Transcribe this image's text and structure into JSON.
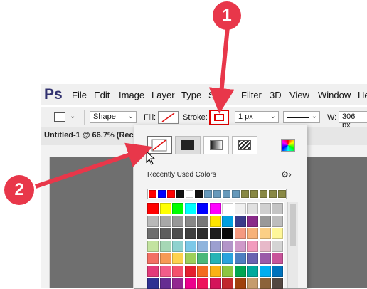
{
  "menubar": {
    "logo": "Ps",
    "items": [
      "File",
      "Edit",
      "Image",
      "Layer",
      "Type",
      "S",
      "Filter",
      "3D",
      "View",
      "Window",
      "He"
    ]
  },
  "options": {
    "tool_mode": "Shape",
    "fill_label": "Fill:",
    "stroke_label": "Stroke:",
    "stroke_width": "1 px",
    "width_label": "W:",
    "width_value": "306 px"
  },
  "document": {
    "tab_title": "Untitled-1 @ 66.7% (Rec"
  },
  "popup": {
    "recent_label": "Recently Used Colors",
    "settings_icon": "gear-icon",
    "recent_colors": [
      "#ff0000",
      "#0000ff",
      "#ff0000",
      "#111111",
      "#ffffff",
      "#111111",
      "#6699bb",
      "#6699bb",
      "#6699bb",
      "#6699bb",
      "#888844",
      "#888844",
      "#888844",
      "#888844",
      "#888844"
    ],
    "swatch_rows": [
      [
        "#ff0000",
        "#ffff00",
        "#00ff00",
        "#00ffff",
        "#0000ff",
        "#ff00ff",
        "#ffffff",
        "#f0f0f0",
        "#e0e0e0",
        "#d0d0d0",
        "#c4c4c4"
      ],
      [
        "#b8b8b8",
        "#a8a8a8",
        "#989898",
        "#888888",
        "#787878",
        "#ffe600",
        "#00a0e0",
        "#3a3a8a",
        "#8a2a8a",
        "#999999",
        "#bdbdbd"
      ],
      [
        "#6e6e6e",
        "#5e5e5e",
        "#4e4e4e",
        "#3e3e3e",
        "#2e2e2e",
        "#1e1e1e",
        "#0a0a0a",
        "#f59a80",
        "#f7b27a",
        "#fbcf86",
        "#fff799"
      ],
      [
        "#c3e3a0",
        "#a6d7b5",
        "#8fd2cf",
        "#7cc8e8",
        "#8fb4dc",
        "#9c9fd0",
        "#b295c8",
        "#cf99c9",
        "#f29bbd",
        "#e7b9c9",
        "#d4d4d4"
      ],
      [
        "#f36f63",
        "#f79a55",
        "#fdd24e",
        "#9dcf5a",
        "#4bb87a",
        "#27b3b5",
        "#2aa3dd",
        "#4d7fc1",
        "#6a63b0",
        "#9a5aa8",
        "#c8549a"
      ],
      [
        "#e23a7a",
        "#f25c8a",
        "#f4516c",
        "#e4202e",
        "#f36b21",
        "#fbb216",
        "#8dc63f",
        "#00a651",
        "#00a99d",
        "#00aeef",
        "#0072bc"
      ],
      [
        "#2e3192",
        "#662d91",
        "#92278f",
        "#ec008c",
        "#ed145b",
        "#d4145a",
        "#c1272d",
        "#a0410d",
        "#c69c6d",
        "#8c6239",
        "#534741"
      ]
    ]
  },
  "annotations": {
    "marker_1": "1",
    "marker_2": "2"
  }
}
